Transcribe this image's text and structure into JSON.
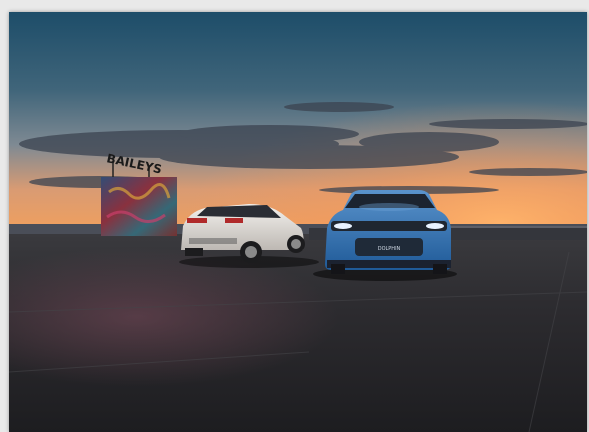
{
  "photo": {
    "subject": "two-electric-hatchbacks-on-rooftop-at-sunset",
    "sign_text": "BAILEYS",
    "badge_text": "DOLPHIN",
    "colors": {
      "sky_top": "#1f4e6a",
      "sky_mid": "#5a7385",
      "sky_horizon": "#f29a5a",
      "ground": "#2a2b2f",
      "car_white": "#e7e4e0",
      "car_blue": "#2f6fb2"
    }
  }
}
